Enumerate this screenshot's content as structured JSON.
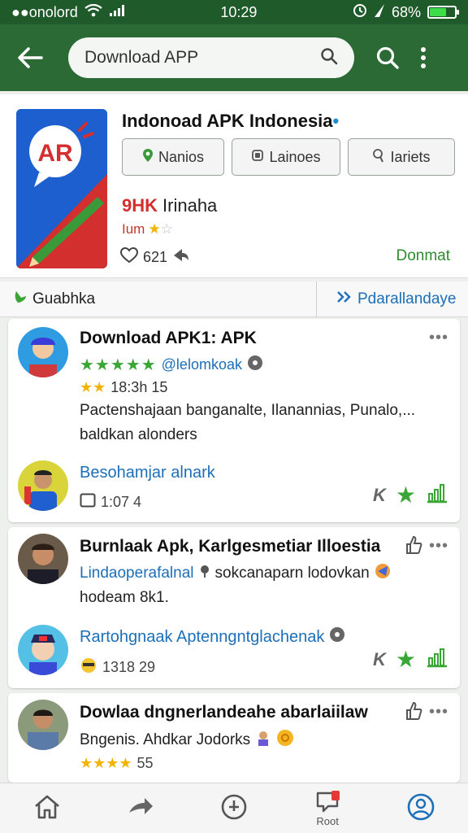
{
  "status": {
    "carrier": "●●onolord",
    "time": "10:29",
    "battery": "68%",
    "battery_level": 0.68
  },
  "appbar": {
    "search_value": "Download APP"
  },
  "app": {
    "title": "Indonoad APK Indonesia",
    "logo_text": "AR",
    "chips": [
      "Nanios",
      "Lainoes",
      "Iariets"
    ],
    "rating_code": "9HK",
    "rating_label": "Irinaha",
    "sub_text": "Ium",
    "likes": "621",
    "download_label": "Donmat"
  },
  "tabs": {
    "left": "Guabhka",
    "right": "Pdarallandaye"
  },
  "cards": [
    {
      "title": "Download APK1: APK",
      "handle": "@lelomkoak",
      "stars": "★★★★★",
      "count_stars": "★★",
      "count": "18:3h 15",
      "body1": "Pactenshajaan banganalte, Ilanannias, Punalo,...",
      "body2": "baldkan alonders",
      "sub_title": "Besohamjar alnark",
      "meta": "1:07  4"
    },
    {
      "title": "Burnlaak Apk, Karlgesmetiar Illoestia",
      "body1": "Lindaoperafalnal",
      "body1b": "sokcanaparn lodovkan",
      "body2": "hodeam 8k1.",
      "sub_title": "Rartohgnaak Aptenngntglachenak",
      "meta": "1318 29"
    },
    {
      "title": "Dowlaa dngnerlandeahe abarlaiilaw",
      "body1": "Bngenis. Ahdkar Jodorks",
      "stars": "★★★★",
      "count": "55"
    }
  ],
  "nav": {
    "post_label": "Root"
  }
}
